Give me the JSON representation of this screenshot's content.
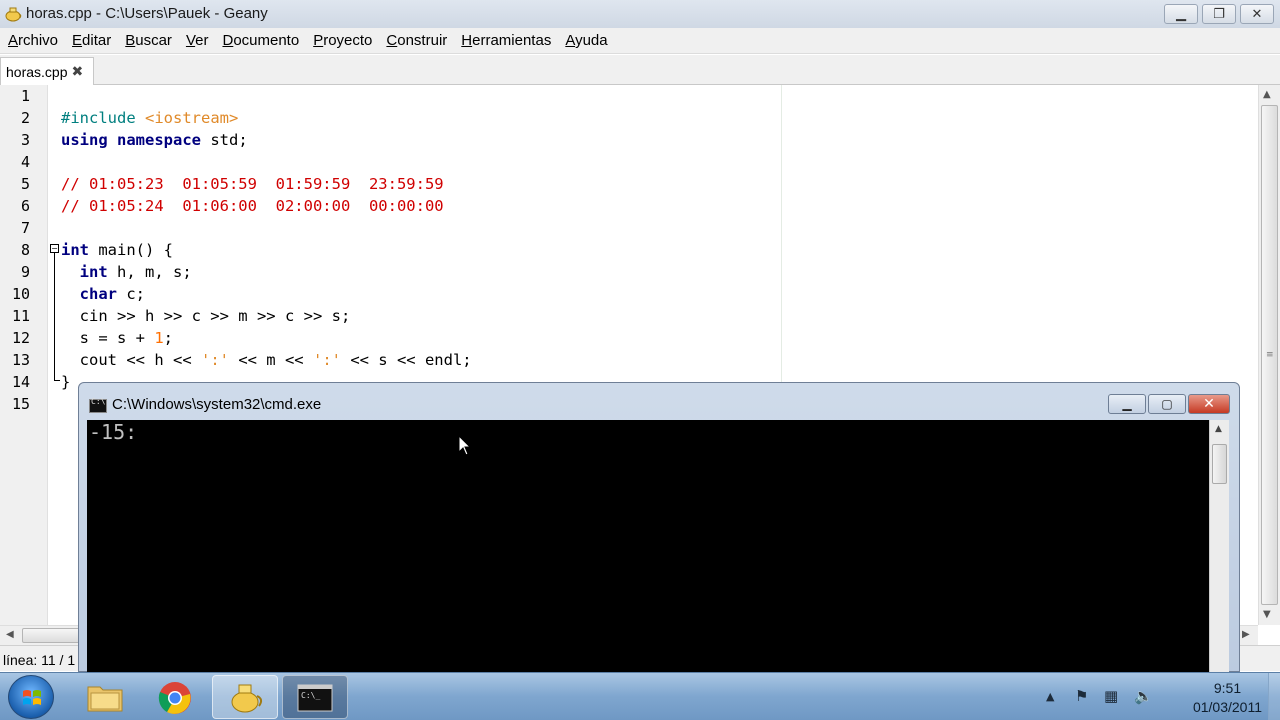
{
  "window": {
    "title": "horas.cpp - C:\\Users\\Pauek - Geany",
    "buttons": {
      "minimize": "▁",
      "maximize": "❐",
      "close": "✕"
    }
  },
  "menu": {
    "items": [
      {
        "label": "Archivo",
        "key": "A",
        "rest": "rchivo"
      },
      {
        "label": "Editar",
        "key": "E",
        "rest": "ditar"
      },
      {
        "label": "Buscar",
        "key": "B",
        "rest": "uscar"
      },
      {
        "label": "Ver",
        "key": "V",
        "rest": "er"
      },
      {
        "label": "Documento",
        "key": "D",
        "rest": "ocumento"
      },
      {
        "label": "Proyecto",
        "key": "P",
        "rest": "royecto"
      },
      {
        "label": "Construir",
        "key": "C",
        "rest": "onstruir"
      },
      {
        "label": "Herramientas",
        "key": "H",
        "rest": "erramientas"
      },
      {
        "label": "Ayuda",
        "key": "A",
        "rest": "yuda"
      }
    ]
  },
  "tab": {
    "label": "horas.cpp",
    "close": "✖"
  },
  "editor": {
    "line_numbers": [
      "1",
      "2",
      "3",
      "4",
      "5",
      "6",
      "7",
      "8",
      "9",
      "10",
      "11",
      "12",
      "13",
      "14",
      "15"
    ],
    "fold_marker": "−",
    "lines": [
      "",
      "#include <iostream>",
      "using namespace std;",
      "",
      "// 01:05:23  01:05:59  01:59:59  23:59:59",
      "// 01:05:24  01:06:00  02:00:00  00:00:00",
      "",
      "int main() {",
      "  int h, m, s;",
      "  char c;",
      "  cin >> h >> c >> m >> c >> s;",
      "  s = s + 1;",
      "  cout << h << ':' << m << ':' << s << endl;",
      "}",
      ""
    ]
  },
  "status": {
    "text": "línea: 11 / 1"
  },
  "cmd": {
    "title": "C:\\Windows\\system32\\cmd.exe",
    "icon_text": "C:\\",
    "buttons": {
      "minimize": "▁",
      "maximize": "▢",
      "close": "✕"
    },
    "output": "-15:"
  },
  "taskbar": {
    "clock_time": "9:51",
    "clock_date": "01/03/2011",
    "tray_arrow": "▲",
    "tray_flag": "⚑",
    "tray_network": "▦",
    "tray_volume": "🔈"
  },
  "colors": {
    "keyword": "#00007f",
    "preprocessor": "#007f7f",
    "include_path": "#e08a2a",
    "comment": "#d00000",
    "number": "#ff6f00",
    "char_literal": "#e08a2a",
    "console_bg": "#000000",
    "console_fg": "#c0c0c0"
  }
}
